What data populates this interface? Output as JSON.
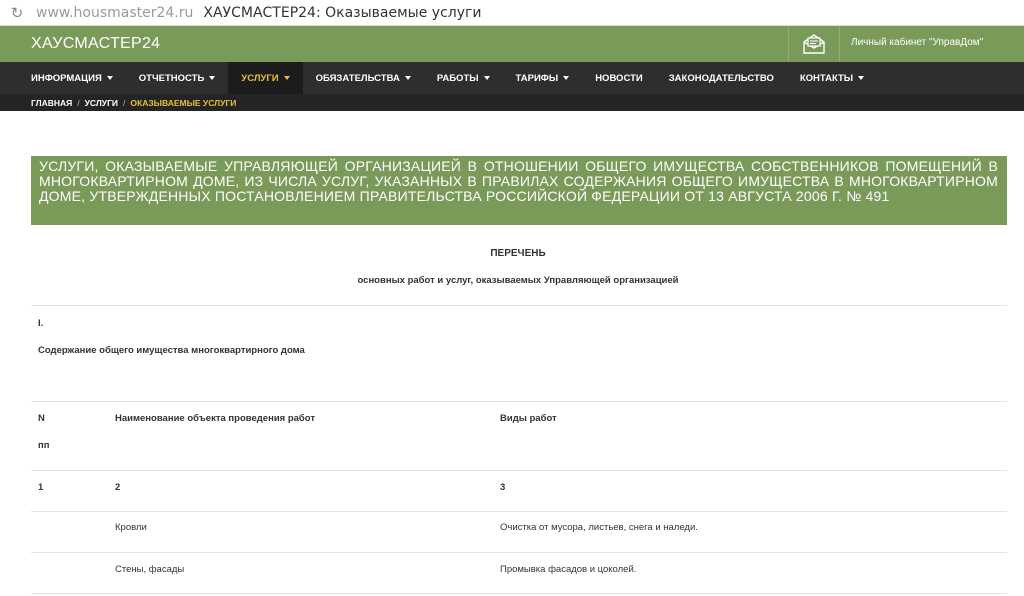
{
  "browser": {
    "url": "www.housmaster24.ru",
    "title": "ХАУСМАСТЕР24: Оказываемые услуги"
  },
  "header": {
    "brand": "ХАУСМАСТЕР24",
    "cabinet_link": "Личный кабинет \"УправДом\"",
    "mail_icon": "envelope-icon"
  },
  "nav": {
    "items": [
      {
        "label": "ИНФОРМАЦИЯ",
        "dropdown": true
      },
      {
        "label": "ОТЧЕТНОСТЬ",
        "dropdown": true
      },
      {
        "label": "УСЛУГИ",
        "dropdown": true,
        "active": true
      },
      {
        "label": "ОБЯЗАТЕЛЬСТВА",
        "dropdown": true
      },
      {
        "label": "РАБОТЫ",
        "dropdown": true
      },
      {
        "label": "ТАРИФЫ",
        "dropdown": true
      },
      {
        "label": "НОВОСТИ",
        "dropdown": false
      },
      {
        "label": "ЗАКОНОДАТЕЛЬСТВО",
        "dropdown": false
      },
      {
        "label": "КОНТАКТЫ",
        "dropdown": true
      }
    ]
  },
  "breadcrumb": {
    "home": "ГЛАВНАЯ",
    "section": "УСЛУГИ",
    "current": "ОКАЗЫВАЕМЫЕ УСЛУГИ",
    "separator": "/"
  },
  "content": {
    "banner": "УСЛУГИ, ОКАЗЫВАЕМЫЕ УПРАВЛЯЮЩЕЙ ОРГАНИЗАЦИЕЙ В ОТНОШЕНИИ ОБЩЕГО ИМУЩЕСТВА СОБСТВЕННИКОВ ПОМЕЩЕНИЙ В МНОГОКВАРТИРНОМ ДОМЕ, ИЗ ЧИСЛА УСЛУГ, УКАЗАННЫХ В ПРАВИЛАХ СОДЕРЖАНИЯ ОБЩЕГО ИМУЩЕСТВА В МНОГОКВАРТИРНОМ ДОМЕ, УТВЕРЖДЕННЫХ ПОСТАНОВЛЕНИЕМ ПРАВИТЕЛЬСТВА РОССИЙСКОЙ ФЕДЕРАЦИИ ОТ 13 АВГУСТА 2006 Г. № 491",
    "list_title": "ПЕРЕЧЕНЬ",
    "list_subtitle": "основных работ и услуг, оказываемых Управляющей организацией",
    "section_number": "I.",
    "section_title": "Содержание общего имущества многоквартирного дома",
    "table": {
      "headers": {
        "num_line1": "N",
        "num_line2": "пп",
        "object": "Наименование объекта проведения работ",
        "works": "Виды работ"
      },
      "numbering": [
        "1",
        "2",
        "3"
      ],
      "rows": [
        {
          "num": "",
          "object": "Кровли",
          "works": "Очистка от мусора, листьев, снега и наледи."
        },
        {
          "num": "",
          "object": "Стены, фасады",
          "works": "Промывка фасадов и цоколей."
        }
      ]
    }
  },
  "colors": {
    "header_green": "#7a9a5a",
    "nav_dark": "#2e2e2e",
    "active_accent": "#e8bf3c"
  }
}
